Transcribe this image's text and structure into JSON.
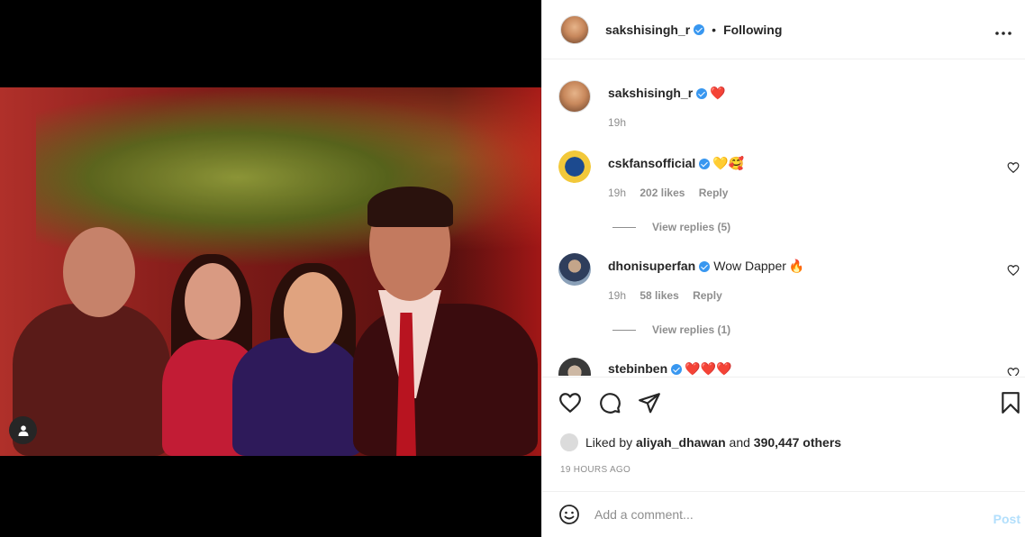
{
  "header": {
    "username": "sakshisingh_r",
    "separator": "•",
    "follow_status": "Following",
    "more_icon": "more-horizontal-icon"
  },
  "comments": [
    {
      "username": "sakshisingh_r",
      "text": "",
      "emoji": "❤️",
      "time": "19h",
      "likes": "",
      "reply": "",
      "avatar_color": "#c8885c"
    },
    {
      "username": "cskfansofficial",
      "text": "",
      "emoji": "💛🥰",
      "time": "19h",
      "likes": "202 likes",
      "reply": "Reply",
      "view_replies": "View replies (5)",
      "avatar_color": "#f2c83a"
    },
    {
      "username": "dhonisuperfan",
      "text": "Wow Dapper",
      "emoji": "🔥",
      "time": "19h",
      "likes": "58 likes",
      "reply": "Reply",
      "view_replies": "View replies (1)",
      "avatar_color": "#3a4a6a"
    },
    {
      "username": "stebinben",
      "text": "",
      "emoji": "❤️❤️❤️",
      "avatar_color": "#5a5a5a"
    }
  ],
  "actions": {
    "like_icon": "heart-icon",
    "comment_icon": "comment-icon",
    "share_icon": "send-icon",
    "save_icon": "bookmark-icon"
  },
  "likes": {
    "prefix": "Liked by",
    "user": "aliyah_dhawan",
    "conj": "and",
    "others": "390,447 others"
  },
  "timestamp": "19 HOURS AGO",
  "composer": {
    "placeholder": "Add a comment...",
    "post_label": "Post",
    "emoji_icon": "smiley-icon"
  },
  "media": {
    "tag_icon": "user-tag-icon"
  },
  "colors": {
    "verified": "#3897f0",
    "muted": "#8e8e8e",
    "text": "#262626",
    "post_disabled": "#b2dffc"
  }
}
